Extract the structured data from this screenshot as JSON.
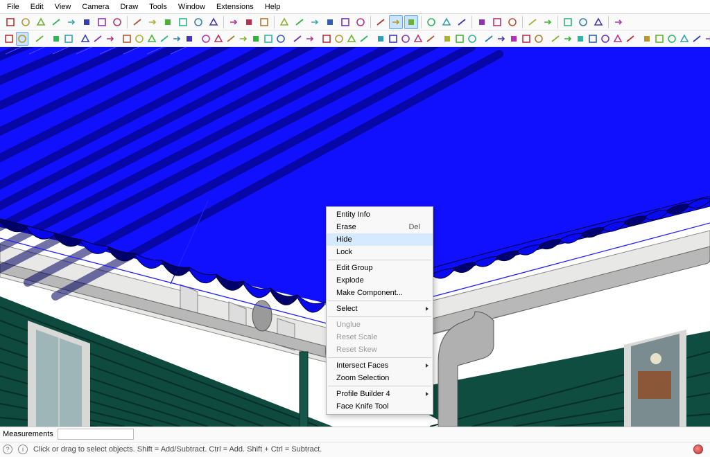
{
  "menu": [
    "File",
    "Edit",
    "View",
    "Camera",
    "Draw",
    "Tools",
    "Window",
    "Extensions",
    "Help"
  ],
  "context_menu": {
    "items": [
      {
        "label": "Entity Info",
        "shortcut": "",
        "enabled": true
      },
      {
        "label": "Erase",
        "shortcut": "Del",
        "enabled": true
      },
      {
        "label": "Hide",
        "shortcut": "",
        "enabled": true,
        "hover": true
      },
      {
        "label": "Lock",
        "shortcut": "",
        "enabled": true
      },
      {
        "sep": true
      },
      {
        "label": "Edit Group",
        "shortcut": "",
        "enabled": true
      },
      {
        "label": "Explode",
        "shortcut": "",
        "enabled": true
      },
      {
        "label": "Make Component...",
        "shortcut": "",
        "enabled": true
      },
      {
        "sep": true
      },
      {
        "label": "Select",
        "submenu": true,
        "enabled": true
      },
      {
        "sep": true
      },
      {
        "label": "Unglue",
        "enabled": false
      },
      {
        "label": "Reset Scale",
        "enabled": false
      },
      {
        "label": "Reset Skew",
        "enabled": false
      },
      {
        "sep": true
      },
      {
        "label": "Intersect Faces",
        "submenu": true,
        "enabled": true
      },
      {
        "label": "Zoom Selection",
        "enabled": true
      },
      {
        "sep": true
      },
      {
        "label": "Profile Builder 4",
        "submenu": true,
        "enabled": true
      },
      {
        "label": "Face Knife Tool",
        "enabled": true
      }
    ]
  },
  "status": {
    "measurements_label": "Measurements",
    "measurements_value": "",
    "hint": "Click or drag to select objects. Shift = Add/Subtract. Ctrl = Add. Shift + Ctrl = Subtract."
  },
  "toolbar_icons_row1": [
    "select",
    "eraser",
    "line",
    "arc",
    "text",
    "boxtxt",
    "tape",
    "person",
    "sep",
    "zoom-ext",
    "zoom-sel",
    "orbit",
    "zoom-win",
    "undo",
    "redo",
    "sep",
    "protractor",
    "dimension",
    "walk",
    "sep",
    "cube",
    "comp",
    "house",
    "layers",
    "paint",
    "3dw",
    "sep",
    "outliner",
    "layers-b",
    "soft",
    "sep",
    "solid1",
    "solid2",
    "solid3",
    "sep",
    "box",
    "cyl",
    "sphere",
    "sep",
    "solid4",
    "solid5",
    "sep",
    "gear1",
    "gear2",
    "gear3",
    "sep",
    "ext1"
  ],
  "toolbar_icons_row2": [
    "zoom",
    "select-arrow",
    "sep",
    "eraser2",
    "sep",
    "pencil",
    "freehand",
    "sep",
    "rect",
    "circle",
    "poly",
    "sep",
    "push",
    "follow",
    "offset",
    "move",
    "rotate",
    "scale",
    "sep",
    "tape2",
    "protractor2",
    "axes",
    "dim2",
    "text2",
    "cam",
    "warn",
    "sep",
    "3dw2",
    "sun",
    "sep",
    "tag1",
    "tag2",
    "tag3",
    "tag4",
    "sep",
    "pb1",
    "pb2",
    "pb3",
    "pb4",
    "pb5",
    "sep",
    "vray1",
    "vray2",
    "vray3",
    "sep",
    "s1",
    "s2",
    "s3",
    "s4",
    "s5",
    "sep",
    "c1",
    "c2",
    "c3",
    "c4",
    "c5",
    "c6",
    "c7",
    "sep",
    "m1",
    "m2",
    "m3",
    "m4",
    "m5",
    "m6",
    "sep",
    "o1",
    "o2",
    "o3",
    "o4"
  ],
  "colors": {
    "selection_blue": "#1010ff",
    "wall_green": "#0e4a3e",
    "trim_white": "#e8e8e6",
    "metal_gray": "#8c8c8c"
  }
}
